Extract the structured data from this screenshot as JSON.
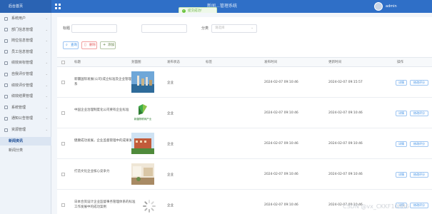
{
  "topbar": {
    "brand": "后台首页",
    "title": "新闻…管理系统",
    "user": "admin"
  },
  "toast": {
    "text": "提交成功!"
  },
  "sidebar": {
    "items": [
      {
        "label": "系统用户",
        "has_arrow": true
      },
      {
        "label": "部门信息管理",
        "has_arrow": true
      },
      {
        "label": "岗位信息管理",
        "has_arrow": true
      },
      {
        "label": "员工信息管理",
        "has_arrow": true
      },
      {
        "label": "绩效目标管理",
        "has_arrow": true
      },
      {
        "label": "自我评价管理",
        "has_arrow": true
      },
      {
        "label": "绩效评价管理",
        "has_arrow": true
      },
      {
        "label": "绩效结果管理",
        "has_arrow": true
      },
      {
        "label": "系统管理",
        "has_arrow": true
      },
      {
        "label": "通知公告管理",
        "has_arrow": true
      },
      {
        "label": "资源管理",
        "has_arrow": true
      }
    ],
    "sub_items": [
      {
        "label": "新闻资讯",
        "active": true
      },
      {
        "label": "新闻分类",
        "active": false
      }
    ]
  },
  "search": {
    "title_label": "标题",
    "tag_label": "标签",
    "category_label": "分类",
    "category_placeholder": "请选择"
  },
  "buttons": {
    "search": "查询",
    "delete": "删除",
    "add": "添加"
  },
  "table": {
    "headers": [
      "标题",
      "封面图",
      "发布状态",
      "标签",
      "发布时间",
      "更新时间",
      "操作"
    ],
    "rows": [
      {
        "title": "新疆国际发展(公司)成立标准及企业管理体系",
        "status": "企业",
        "tag": "",
        "publish": "2024-02-07 09:10:46",
        "update": "2024-02-07 09:15:57",
        "image": "city"
      },
      {
        "title": "中国企业治理制度化公司要有企业标准",
        "status": "企业",
        "tag": "",
        "publish": "2024-02-07 09:10:46",
        "update": "2024-02-07 09:10:46",
        "image": "logo"
      },
      {
        "title": "健康成功发展，企业监督管理中的成果发展",
        "status": "企业",
        "tag": "",
        "publish": "2024-02-07 09:10:46",
        "update": "2024-02-07 09:10:46",
        "image": "building"
      },
      {
        "title": "打造文化企业核心竞争力",
        "status": "企业",
        "tag": "",
        "publish": "2024-02-07 09:10:46",
        "update": "2024-02-07 09:10:46",
        "image": "interior"
      },
      {
        "title": "日本合资设计企业监督事务管理体系的标准工作发展中的成功案例",
        "status": "企业",
        "tag": "",
        "publish": "2024-02-07 09:10:46",
        "update": "2024-02-07 09:10:46",
        "image": "loading"
      }
    ],
    "detail_label": "详情",
    "edit_label": "修改评分"
  },
  "logo_text": "新疆物联网产业",
  "watermark": "CSDN @vx_CKKF10086"
}
